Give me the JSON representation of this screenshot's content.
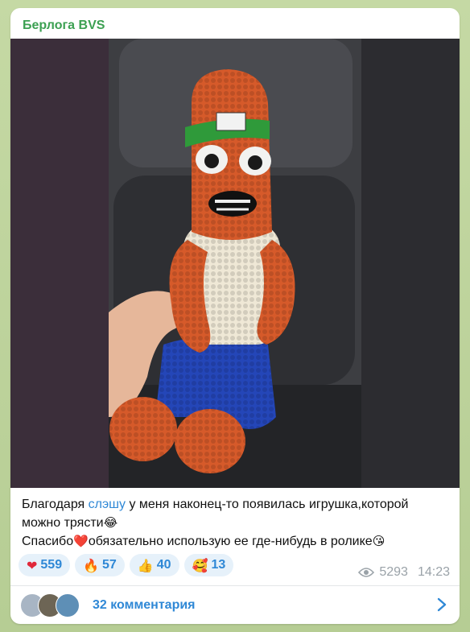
{
  "channel": {
    "name": "Берлога BVS"
  },
  "post": {
    "photo_alt": "",
    "caption": {
      "part1": "Благодаря ",
      "link": "слэшу",
      "part2": " у меня наконец-то появилась игрушка,которой можно трясти",
      "emoji1": "😂",
      "part3": "Спасибо",
      "emoji2": "❤️",
      "part4": "обязательно использую ее где-нибудь в ролике",
      "emoji3": "😘"
    },
    "reactions": [
      {
        "emoji": "❤",
        "count": "559",
        "icon": "heart-icon"
      },
      {
        "emoji": "🔥",
        "count": "57",
        "icon": "fire-icon"
      },
      {
        "emoji": "👍",
        "count": "40",
        "icon": "thumbs-up-icon"
      },
      {
        "emoji": "🥰",
        "count": "13",
        "icon": "smiling-hearts-icon"
      }
    ],
    "views": "5293",
    "time": "14:23"
  },
  "comments": {
    "label": "32 комментария"
  },
  "colors": {
    "accent": "#2f88d6",
    "channel": "#3ca052",
    "background": "#b9cf9a"
  }
}
